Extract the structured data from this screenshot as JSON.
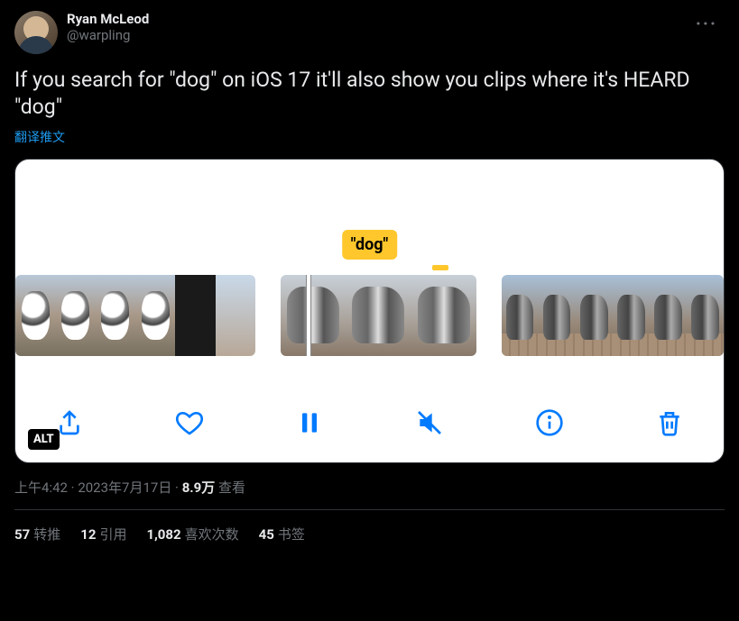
{
  "user": {
    "display_name": "Ryan McLeod",
    "handle": "@warpling"
  },
  "tweet": {
    "text": "If you search for \"dog\" on iOS 17 it'll also show you clips where it's HEARD \"dog\"",
    "translate_label": "翻译推文",
    "media_badge": "\"dog\"",
    "alt_label": "ALT"
  },
  "meta": {
    "time": "上午4:42",
    "sep1": " · ",
    "date": "2023年7月17日",
    "sep2": " · ",
    "views_count": "8.9万",
    "views_label": " 查看"
  },
  "stats": {
    "retweets": {
      "count": "57",
      "label": "转推"
    },
    "quotes": {
      "count": "12",
      "label": "引用"
    },
    "likes": {
      "count": "1,082",
      "label": "喜欢次数"
    },
    "bookmarks": {
      "count": "45",
      "label": "书签"
    }
  }
}
